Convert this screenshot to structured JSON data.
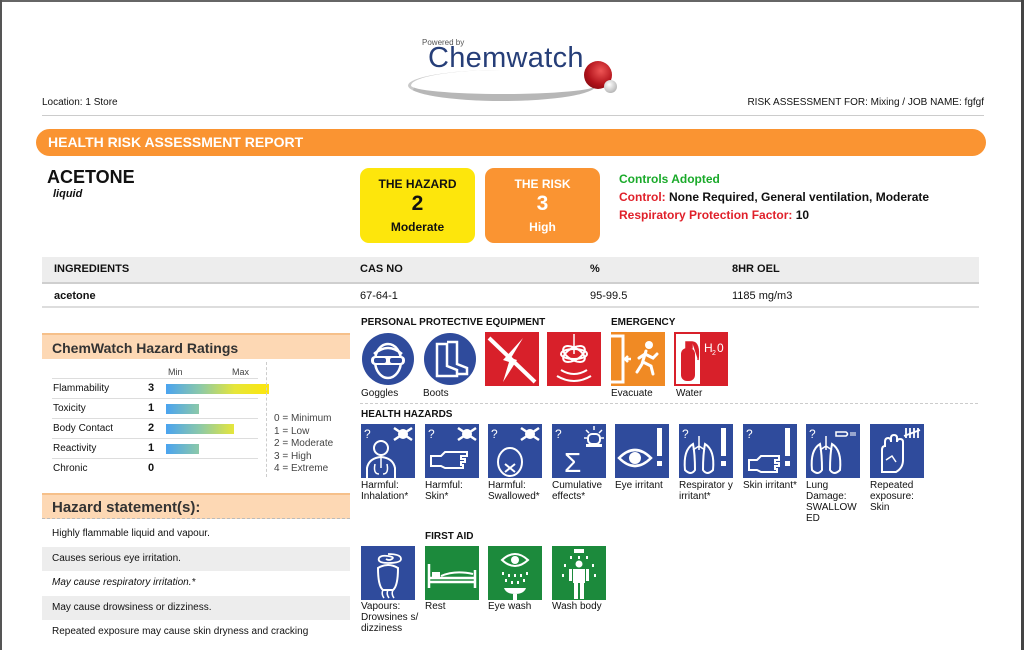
{
  "logo": {
    "powered_by": "Powered by",
    "brand": "Chemwatch"
  },
  "header": {
    "location": "Location:  1 Store",
    "risk_assessment_for": "RISK ASSESSMENT FOR: Mixing / JOB NAME: fgfgf"
  },
  "banner": {
    "title": "HEALTH RISK ASSESSMENT REPORT"
  },
  "chemical": {
    "name": "ACETONE",
    "state": "liquid"
  },
  "hazard_badge": {
    "title": "THE HAZARD",
    "value": "2",
    "level": "Moderate",
    "color": "#fde60c"
  },
  "risk_badge": {
    "title": "THE RISK",
    "value": "3",
    "level": "High",
    "color": "#fa9432"
  },
  "controls": {
    "heading": "Controls Adopted",
    "control_label": "Control:",
    "control_value": "None Required, General ventilation, Moderate",
    "rpf_label": "Respiratory Protection Factor:",
    "rpf_value": "10"
  },
  "ingredients": {
    "headers": [
      "INGREDIENTS",
      "CAS NO",
      "%",
      "8HR OEL"
    ],
    "rows": [
      {
        "name": "acetone",
        "cas": "67-64-1",
        "percent": "95-99.5",
        "oel": "1185 mg/m3"
      }
    ]
  },
  "hazard_ratings": {
    "title": "ChemWatch Hazard Ratings",
    "min_label": "Min",
    "max_label": "Max",
    "scale_max": 4,
    "items": [
      {
        "label": "Flammability",
        "value": 3
      },
      {
        "label": "Toxicity",
        "value": 1
      },
      {
        "label": "Body Contact",
        "value": 2
      },
      {
        "label": "Reactivity",
        "value": 1
      },
      {
        "label": "Chronic",
        "value": 0
      }
    ],
    "legend": [
      "0 = Minimum",
      "1 = Low",
      "2 = Moderate",
      "3 = High",
      "4 = Extreme"
    ]
  },
  "hazard_statements": {
    "title": "Hazard statement(s):",
    "items": [
      "Highly flammable liquid and vapour.",
      "Causes serious eye irritation.",
      "May cause respiratory irritation.*",
      "May cause drowsiness or dizziness.",
      "Repeated exposure may cause skin dryness and cracking"
    ]
  },
  "ppe": {
    "title": "PERSONAL PROTECTIVE EQUIPMENT",
    "items": [
      {
        "icon": "goggles-icon",
        "caption": "Goggles"
      },
      {
        "icon": "boots-icon",
        "caption": "Boots"
      },
      {
        "icon": "no-static-icon",
        "caption": ""
      },
      {
        "icon": "no-vibration-icon",
        "caption": ""
      }
    ]
  },
  "emergency": {
    "title": "EMERGENCY",
    "items": [
      {
        "icon": "evacuate-icon",
        "caption": "Evacuate"
      },
      {
        "icon": "water-extinguisher-icon",
        "caption": "Water",
        "badge": "H2O"
      }
    ]
  },
  "health_hazards": {
    "title": "HEALTH HAZARDS",
    "items": [
      {
        "icon": "harmful-inhalation-icon",
        "caption": "Harmful: Inhalation*"
      },
      {
        "icon": "harmful-skin-icon",
        "caption": "Harmful: Skin*"
      },
      {
        "icon": "harmful-swallowed-icon",
        "caption": "Harmful: Swallowed*"
      },
      {
        "icon": "cumulative-effects-icon",
        "caption": "Cumulative effects*"
      },
      {
        "icon": "eye-irritant-icon",
        "caption": "Eye irritant"
      },
      {
        "icon": "respiratory-irritant-icon",
        "caption": "Respirator y irritant*"
      },
      {
        "icon": "skin-irritant-icon",
        "caption": "Skin irritant*"
      },
      {
        "icon": "lung-damage-icon",
        "caption": "Lung Damage: SWALLOW ED"
      },
      {
        "icon": "repeated-exposure-skin-icon",
        "caption": "Repeated exposure: Skin"
      },
      {
        "icon": "vapours-drowsiness-icon",
        "caption": "Vapours: Drowsines s/ dizziness"
      }
    ]
  },
  "first_aid": {
    "title": "FIRST AID",
    "items": [
      {
        "icon": "rest-icon",
        "caption": "Rest"
      },
      {
        "icon": "eye-wash-icon",
        "caption": "Eye wash"
      },
      {
        "icon": "wash-body-icon",
        "caption": "Wash body"
      }
    ]
  },
  "colors": {
    "banner_orange": "#fa9432",
    "section_peach": "#fdd8b4",
    "hazard_blue": "#2f4b9c",
    "danger_red": "#d8202a",
    "emergency_orange": "#f08a24",
    "firstaid_green": "#1c8a3c",
    "controls_green": "#1aaa2a",
    "controls_red": "#e0202a"
  }
}
